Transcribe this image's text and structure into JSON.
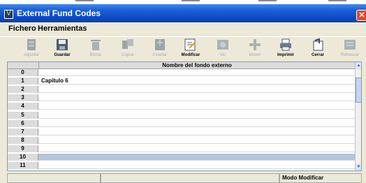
{
  "window": {
    "title": "External Fund Codes",
    "close_glyph": "✕"
  },
  "menu": [
    "Fichero",
    "Herramientas"
  ],
  "toolbar": [
    {
      "label": "Adjuntar",
      "icon": "attach-icon",
      "enabled": false
    },
    {
      "label": "Guardar",
      "icon": "save-icon",
      "enabled": true
    },
    {
      "label": "Borrar",
      "icon": "trash-icon",
      "enabled": false
    },
    {
      "label": "Copiar",
      "icon": "copy-icon",
      "enabled": false
    },
    {
      "label": "Insertar",
      "icon": "insert-icon",
      "enabled": false
    },
    {
      "label": "Modificar",
      "icon": "edit-icon",
      "enabled": true
    },
    {
      "label": "Ver",
      "icon": "view-icon",
      "enabled": false
    },
    {
      "label": "Mover",
      "icon": "move-icon",
      "enabled": false
    },
    {
      "label": "Imprimir",
      "icon": "printer-icon",
      "enabled": true
    },
    {
      "label": "Cerrar",
      "icon": "close-door-icon",
      "enabled": true
    },
    {
      "label": "Refrescar",
      "icon": "refresh-icon",
      "enabled": false
    }
  ],
  "table": {
    "column_header": "Nombre del fondo externo",
    "rows": [
      {
        "num": "0",
        "value": ""
      },
      {
        "num": "1",
        "value": "Capítulo 6"
      },
      {
        "num": "2",
        "value": ""
      },
      {
        "num": "3",
        "value": ""
      },
      {
        "num": "4",
        "value": ""
      },
      {
        "num": "5",
        "value": ""
      },
      {
        "num": "6",
        "value": ""
      },
      {
        "num": "7",
        "value": ""
      },
      {
        "num": "8",
        "value": ""
      },
      {
        "num": "9",
        "value": ""
      },
      {
        "num": "10",
        "value": ""
      },
      {
        "num": "11",
        "value": ""
      }
    ],
    "selected_row": "10"
  },
  "status": {
    "mode": "Modo Modificar"
  }
}
